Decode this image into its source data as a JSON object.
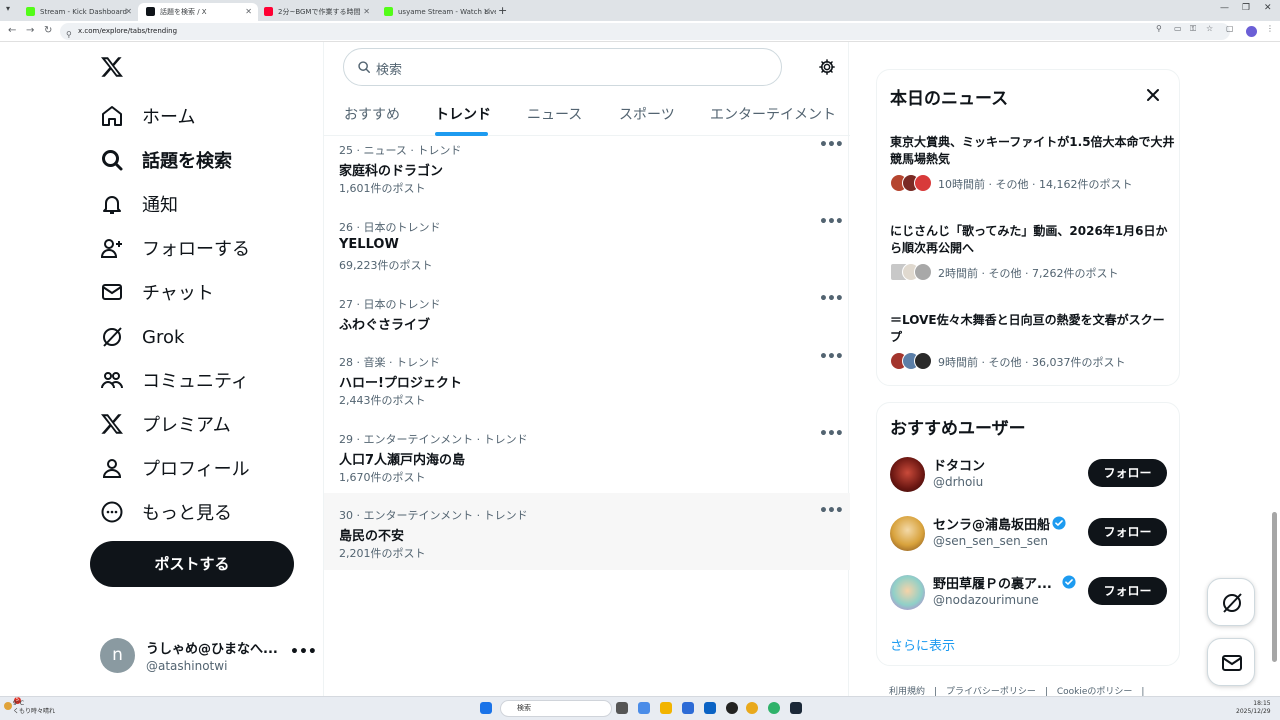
{
  "browser": {
    "tabs": [
      {
        "title": "Stream - Kick Dashboard",
        "favicon_color": "#53fc18"
      },
      {
        "title": "話題を検索 / X",
        "favicon_color": "#0f1419"
      },
      {
        "title": "2分~BGMで作業する時間",
        "favicon_color": "#ff0033"
      },
      {
        "title": "usyame Stream - Watch Live on Kick",
        "favicon_color": "#53fc18"
      }
    ],
    "url": "x.com/explore/tabs/trending"
  },
  "nav": {
    "items": [
      {
        "label": "ホーム",
        "icon": "home-icon"
      },
      {
        "label": "話題を検索",
        "icon": "search-icon"
      },
      {
        "label": "通知",
        "icon": "bell-icon"
      },
      {
        "label": "フォローする",
        "icon": "add-person-icon"
      },
      {
        "label": "チャット",
        "icon": "mail-icon"
      },
      {
        "label": "Grok",
        "icon": "grok-icon"
      },
      {
        "label": "コミュニティ",
        "icon": "community-icon"
      },
      {
        "label": "プレミアム",
        "icon": "x-logo-icon"
      },
      {
        "label": "プロフィール",
        "icon": "person-icon"
      },
      {
        "label": "もっと見る",
        "icon": "more-circle-icon"
      }
    ],
    "post_label": "ポストする",
    "account": {
      "avatar_letter": "n",
      "name": "うしゃめ@ひまなへ...",
      "handle": "@atashinotwi",
      "more": "•••"
    }
  },
  "search": {
    "placeholder": "検索"
  },
  "tabs": [
    "おすすめ",
    "トレンド",
    "ニュース",
    "スポーツ",
    "エンターテイメント"
  ],
  "active_tab": "トレンド",
  "trends": [
    {
      "meta": "25 · ニュース · トレンド",
      "title": "家庭科のドラゴン",
      "count": "1,601件のポスト"
    },
    {
      "meta": "26 · 日本のトレンド",
      "title": "YELLOW",
      "count": "69,223件のポスト"
    },
    {
      "meta": "27 · 日本のトレンド",
      "title": "ふわぐさライブ",
      "count": ""
    },
    {
      "meta": "28 · 音楽 · トレンド",
      "title": "ハロー!プロジェクト",
      "count": "2,443件のポスト"
    },
    {
      "meta": "29 · エンターテインメント · トレンド",
      "title": "人口7人瀬戸内海の島",
      "count": "1,670件のポスト"
    },
    {
      "meta": "30 · エンターテインメント · トレンド",
      "title": "島民の不安",
      "count": "2,201件のポスト"
    }
  ],
  "trend_more": "•••",
  "news": {
    "title": "本日のニュース",
    "items": [
      {
        "title": "東京大賞典、ミッキーファイトが1.5倍大本命で大井競馬場熱気",
        "meta": "10時間前 · その他 · 14,162件のポスト"
      },
      {
        "title": "にじさんじ「歌ってみた」動画、2026年1月6日から順次再公開へ",
        "meta": "2時間前 · その他 · 7,262件のポスト"
      },
      {
        "title": "＝LOVE佐々木舞香と日向亘の熱愛を文春がスクープ",
        "meta": "9時間前 · その他 · 36,037件のポスト"
      }
    ]
  },
  "who_to_follow": {
    "title": "おすすめユーザー",
    "users": [
      {
        "name": "ドタコン",
        "handle": "@drhoiu",
        "verified": false,
        "follow": "フォロー"
      },
      {
        "name": "センラ@浦島坂田船",
        "handle": "@sen_sen_sen_sen",
        "verified": true,
        "follow": "フォロー"
      },
      {
        "name": "野田草履Ｐの裏ア...",
        "handle": "@nodazourimune",
        "verified": true,
        "follow": "フォロー"
      }
    ],
    "show_more": "さらに表示"
  },
  "footer": "利用規約　|　プライバシーポリシー　|　Cookieのポリシー　|",
  "taskbar": {
    "weather_temp": "9°C",
    "weather_desc": "くもり時々晴れ",
    "weather_badge": "5",
    "search_placeholder": "検索",
    "time": "18:15",
    "date": "2025/12/29"
  }
}
